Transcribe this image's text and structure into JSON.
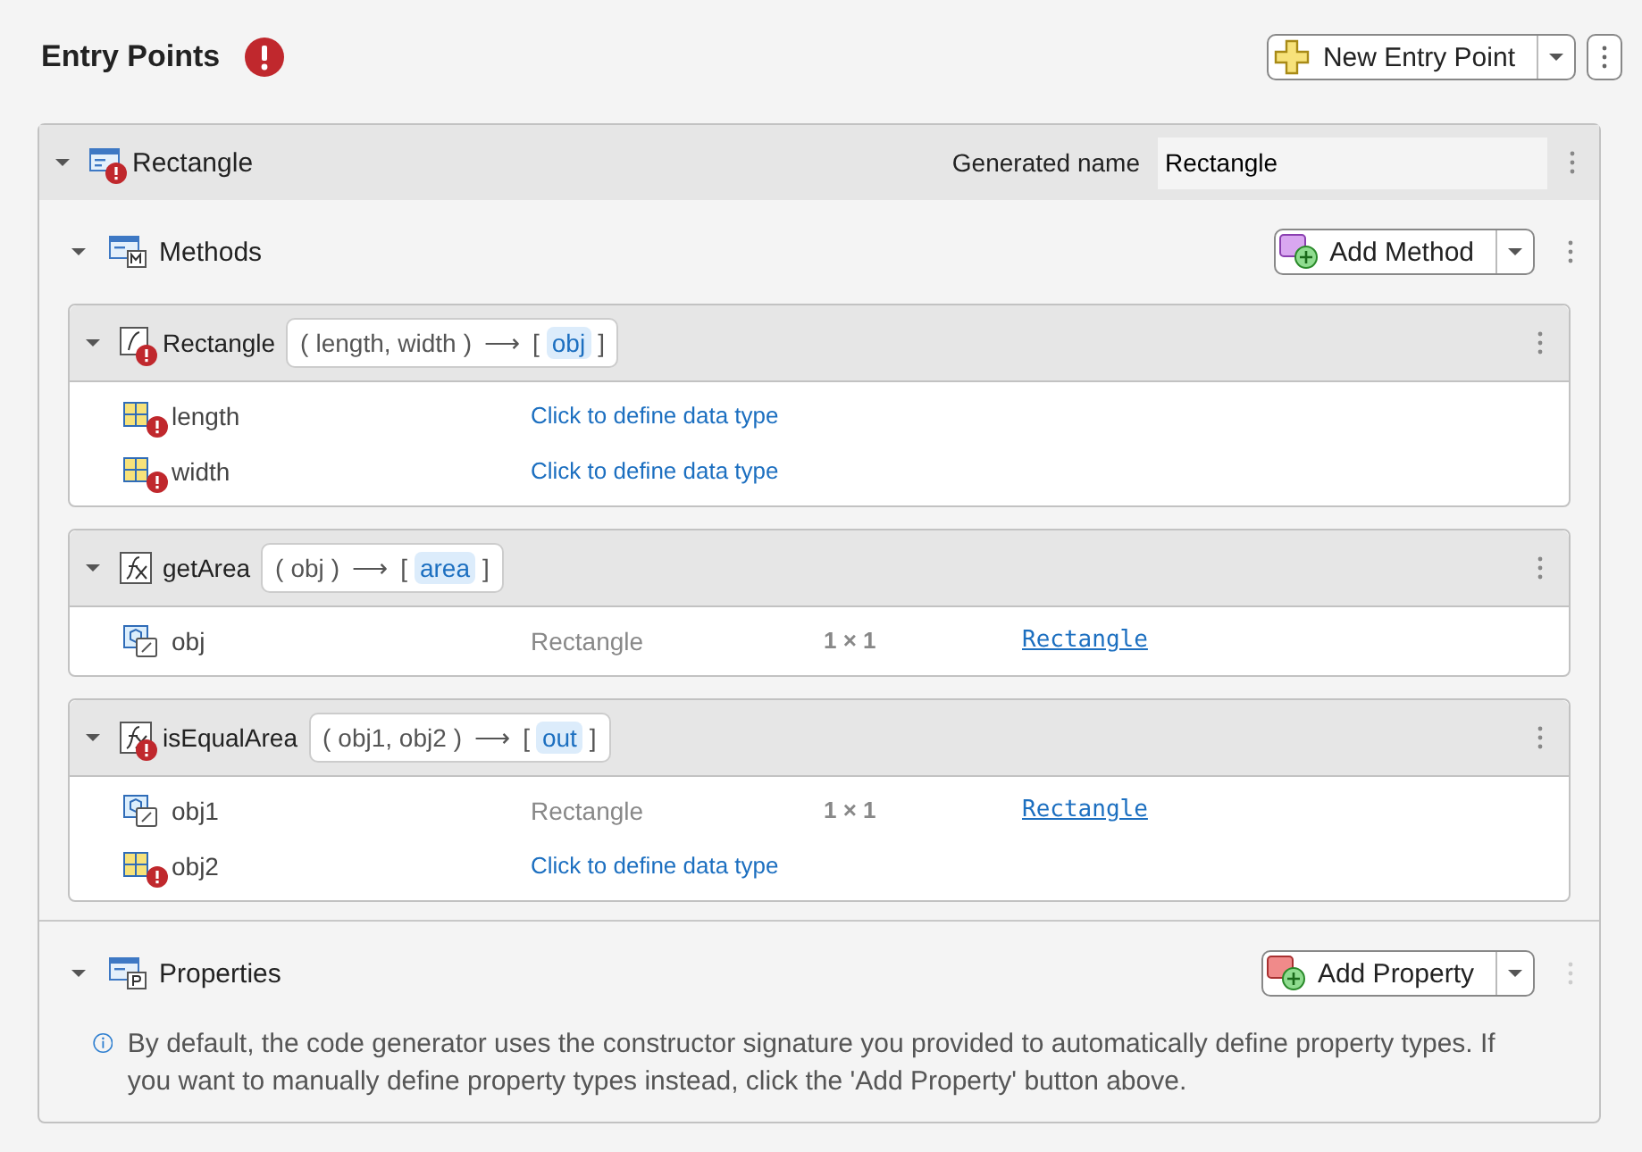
{
  "header": {
    "title": "Entry Points",
    "error": true,
    "new_button": "New Entry Point"
  },
  "entry": {
    "name": "Rectangle",
    "expanded": true,
    "error": true,
    "generated_label": "Generated name",
    "generated_value": "Rectangle",
    "methods_section": {
      "label": "Methods",
      "expanded": true,
      "add_button": "Add Method"
    },
    "methods": [
      {
        "kind": "constructor",
        "name": "Rectangle",
        "error": true,
        "expanded": true,
        "sig": {
          "open": "(",
          "inputs": "length, width",
          "close": ")",
          "arrow": "⟶",
          "out_open": "[",
          "output": "obj",
          "out_close": "]"
        },
        "args": [
          {
            "kind": "undefined",
            "name": "length",
            "error": true,
            "action": "Click to define data type"
          },
          {
            "kind": "undefined",
            "name": "width",
            "error": true,
            "action": "Click to define data type"
          }
        ]
      },
      {
        "kind": "function",
        "name": "getArea",
        "error": false,
        "expanded": true,
        "sig": {
          "open": "(",
          "inputs": "obj",
          "close": ")",
          "arrow": "⟶",
          "out_open": "[",
          "output": "area",
          "out_close": "]"
        },
        "args": [
          {
            "kind": "object",
            "name": "obj",
            "error": false,
            "type": "Rectangle",
            "size": "1 × 1",
            "link": "Rectangle"
          }
        ]
      },
      {
        "kind": "function",
        "name": "isEqualArea",
        "error": true,
        "expanded": true,
        "sig": {
          "open": "(",
          "inputs": "obj1, obj2",
          "close": ")",
          "arrow": "⟶",
          "out_open": "[",
          "output": "out",
          "out_close": "]"
        },
        "args": [
          {
            "kind": "object",
            "name": "obj1",
            "error": false,
            "type": "Rectangle",
            "size": "1 × 1",
            "link": "Rectangle"
          },
          {
            "kind": "undefined",
            "name": "obj2",
            "error": true,
            "action": "Click to define data type"
          }
        ]
      }
    ],
    "properties_section": {
      "label": "Properties",
      "expanded": true,
      "add_button": "Add Property",
      "info": "By default, the code generator uses the constructor signature you provided to automatically define property types. If you want to manually define property types instead, click the 'Add Property' button above."
    }
  }
}
